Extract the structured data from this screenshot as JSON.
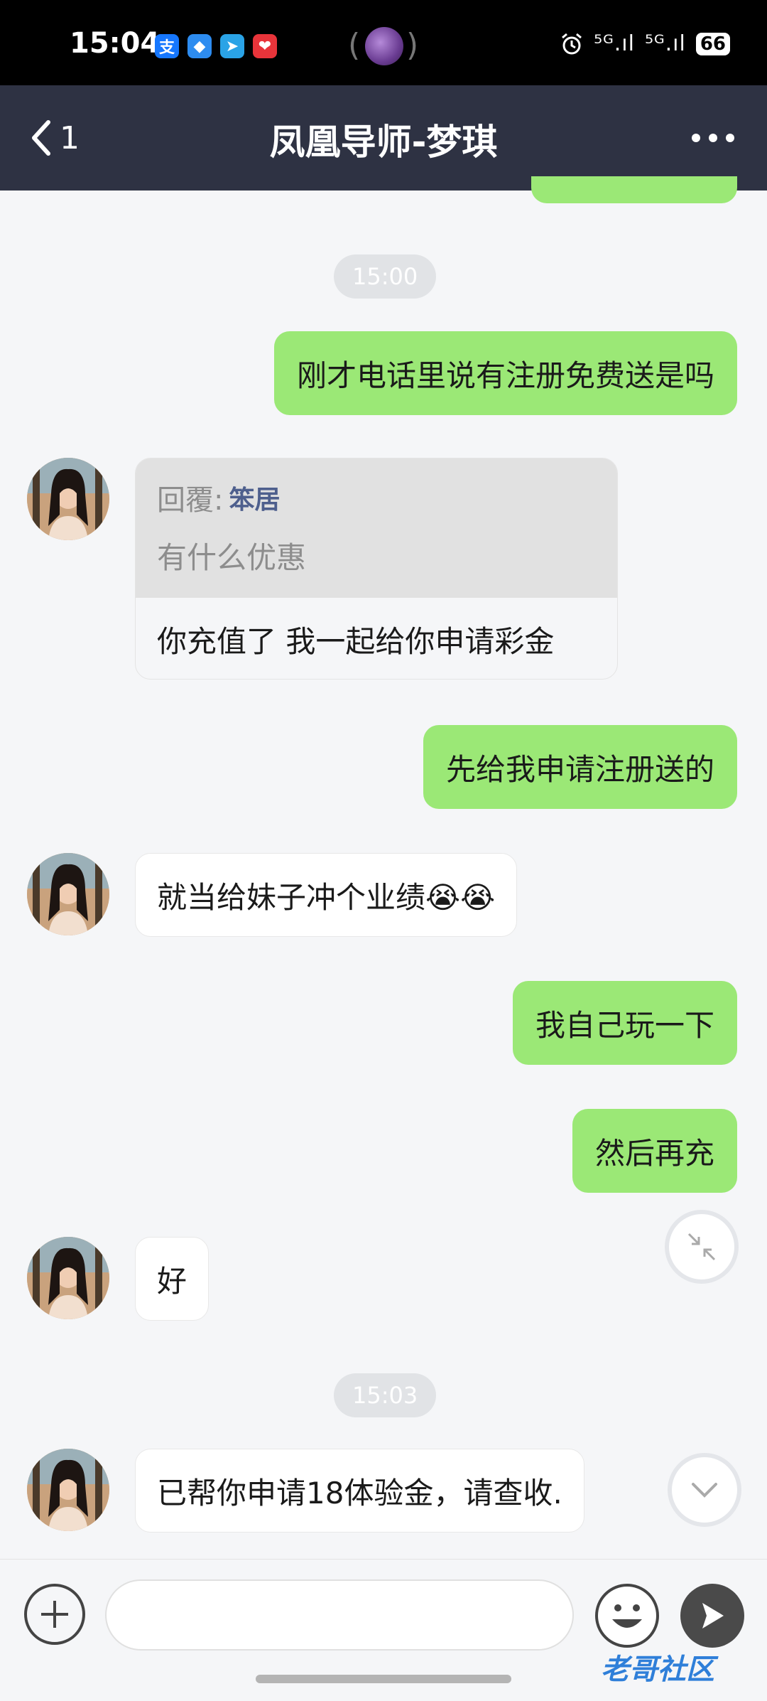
{
  "status_bar": {
    "time": "15:04",
    "app_icons": [
      {
        "name": "alipay-icon",
        "glyph": "支",
        "color": "#1677ff"
      },
      {
        "name": "blue-note-icon",
        "glyph": "◆",
        "color": "#2d8cf0"
      },
      {
        "name": "telegram-icon",
        "glyph": "➤",
        "color": "#2aa3e6"
      },
      {
        "name": "heart-app-icon",
        "glyph": "❤",
        "color": "#e8343a"
      }
    ],
    "signal1": "⁵ᴳ.ıl",
    "signal2": "⁵ᴳ.ıl",
    "battery": "66"
  },
  "header": {
    "back_count": "1",
    "title": "凤凰导师-梦琪"
  },
  "messages": {
    "time1": "15:00",
    "out1": "刚才电话里说有注册免费送是吗",
    "reply": {
      "prefix": "回覆:",
      "user": "笨居",
      "quoted": "有什么优惠",
      "answer": "你充值了 我一起给你申请彩金"
    },
    "out2": "先给我申请注册送的",
    "in1": "就当给妹子冲个业绩😭😭",
    "out3": "我自己玩一下",
    "out4": "然后再充",
    "in2": "好",
    "time2": "15:03",
    "in3": "已帮你申请18体验金，请查收."
  },
  "input": {
    "placeholder": ""
  },
  "watermark": "老哥社区",
  "colors": {
    "header_bg": "#2e3243",
    "outgoing_bubble": "#9be876",
    "incoming_bubble": "#ffffff",
    "chat_bg": "#f5f6f8"
  }
}
